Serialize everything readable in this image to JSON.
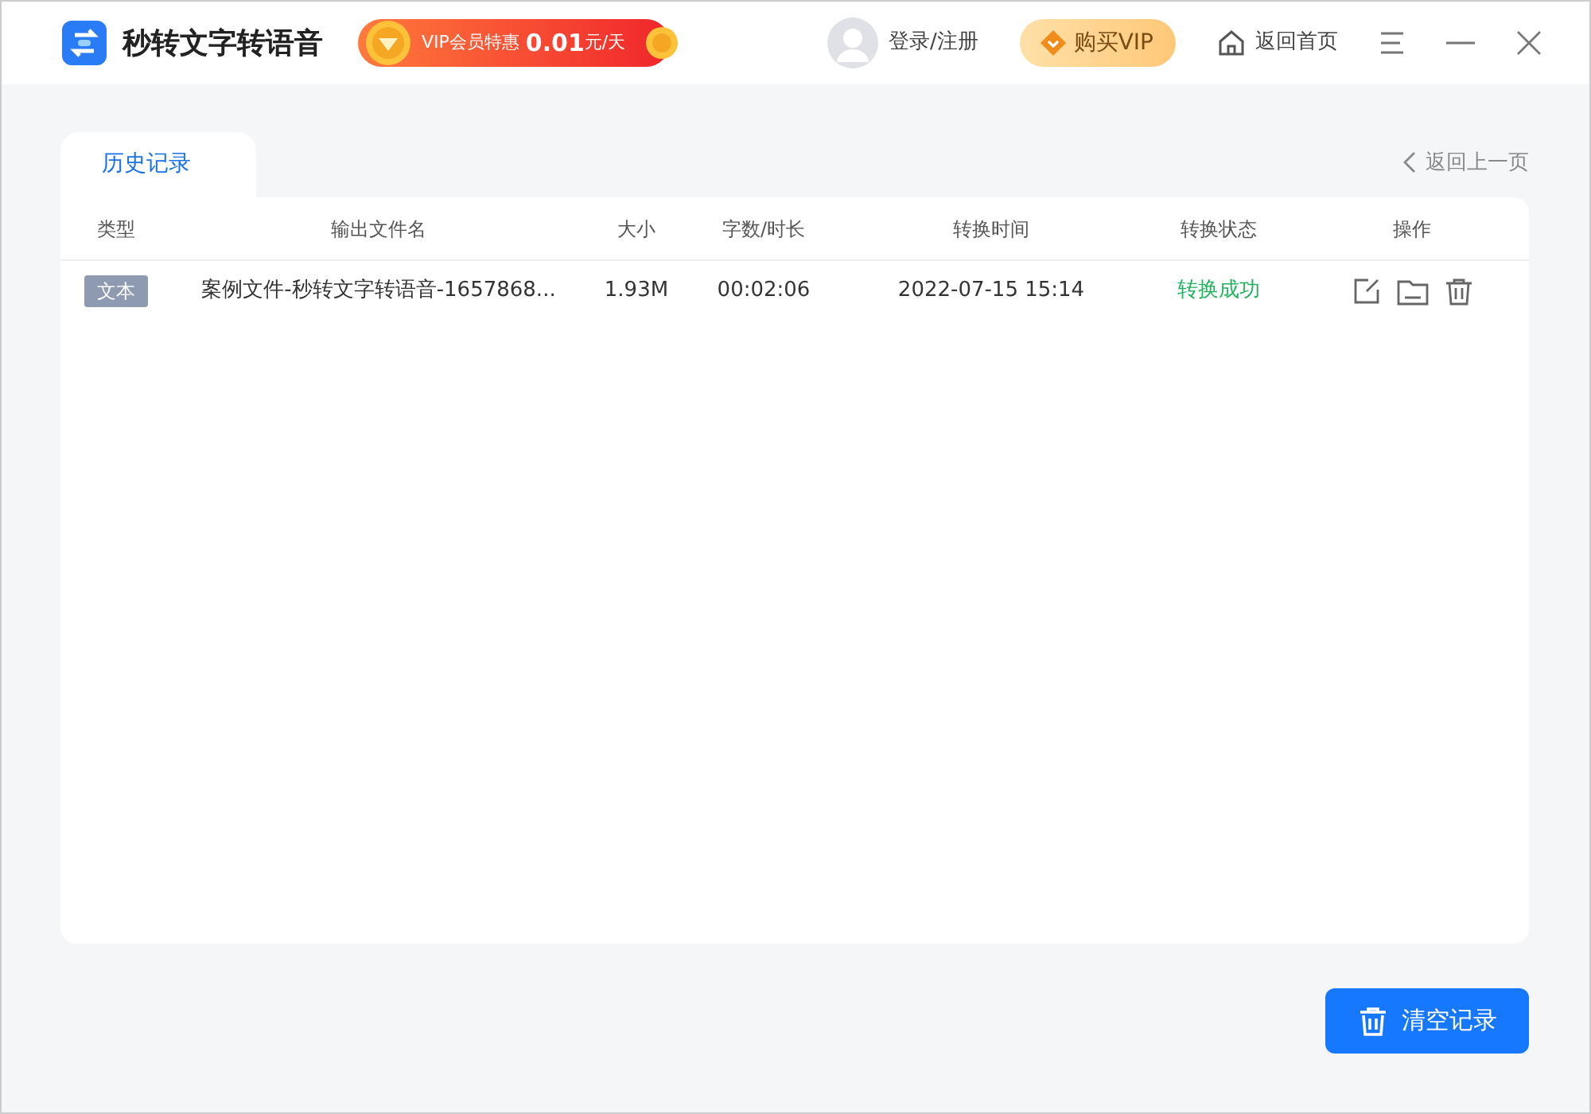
{
  "app": {
    "title": "秒转文字转语音",
    "promo": {
      "label": "VIP会员特惠",
      "price": "0.01",
      "unit": "元/天"
    }
  },
  "header": {
    "login": "登录/注册",
    "buy_vip": "购买VIP",
    "home": "返回首页"
  },
  "tabs": [
    {
      "label": "历史记录",
      "selected": true
    }
  ],
  "back_link": "返回上一页",
  "table": {
    "columns": [
      "类型",
      "输出文件名",
      "大小",
      "字数/时长",
      "转换时间",
      "转换状态",
      "操作"
    ],
    "rows": [
      {
        "type": "文本",
        "filename": "案例文件-秒转文字转语音-1657868...",
        "size": "1.93M",
        "duration": "00:02:06",
        "time": "2022-07-15 15:14",
        "status": "转换成功",
        "succeeded": true
      }
    ]
  },
  "clear_button": "清空记录"
}
